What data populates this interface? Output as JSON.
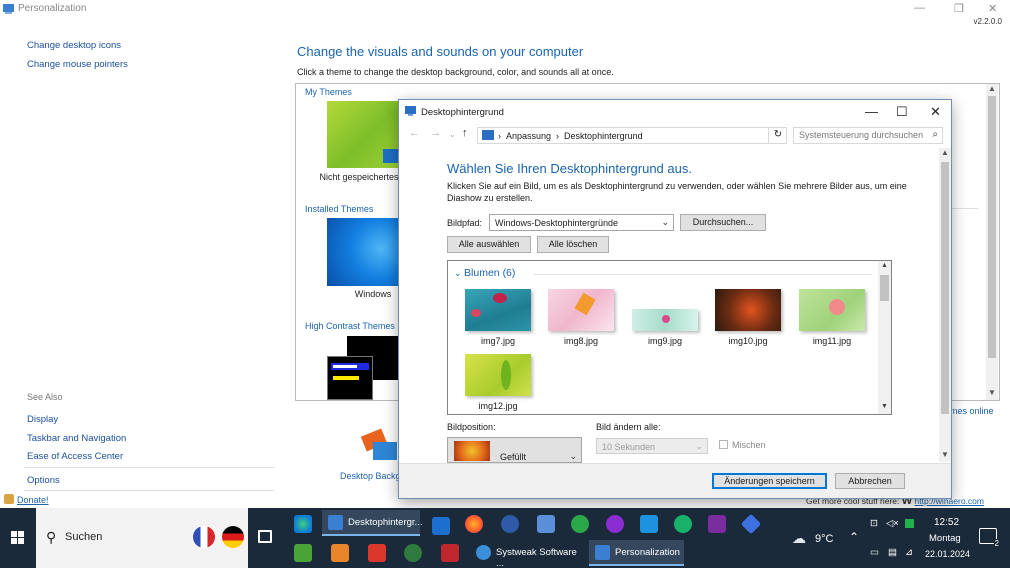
{
  "personalization": {
    "title": "Personalization",
    "version": "v2.2.0.0",
    "left_links": [
      "Change desktop icons",
      "Change mouse pointers"
    ],
    "see_also_label": "See Also",
    "see_also_links": [
      "Display",
      "Taskbar and Navigation",
      "Ease of Access Center",
      "Options"
    ],
    "donate": "Donate!",
    "heading": "Change the visuals and sounds on your computer",
    "subheading": "Click a theme to change the desktop background, color, and sounds all at once.",
    "groups": {
      "my": "My Themes",
      "installed": "Installed Themes",
      "high_contrast": "High Contrast Themes"
    },
    "theme_captions": {
      "unsaved": "Nicht gespeichertes",
      "windows": "Windows"
    },
    "more_online": "mes online",
    "bottom_item": "Desktop Backg",
    "get_more": {
      "text": "Get more cool stuff here:",
      "w": "W",
      "link": "http://winaero.com"
    }
  },
  "dialog": {
    "title": "Desktophintergrund",
    "breadcrumb": [
      "Anpassung",
      "Desktophintergrund"
    ],
    "search_placeholder": "Systemsteuerung durchsuchen",
    "heading": "Wählen Sie Ihren Desktophintergrund aus.",
    "description": "Klicken Sie auf ein Bild, um es als Desktophintergrund zu verwenden, oder wählen Sie mehrere Bilder aus, um eine Diashow zu erstellen.",
    "path_label": "Bildpfad:",
    "path_value": "Windows-Desktophintergründe",
    "browse": "Durchsuchen...",
    "select_all": "Alle auswählen",
    "clear_all": "Alle löschen",
    "group": "Blumen (6)",
    "images": [
      "img7.jpg",
      "img8.jpg",
      "img9.jpg",
      "img10.jpg",
      "img11.jpg",
      "img12.jpg"
    ],
    "position_label": "Bildposition:",
    "position_value": "Gefüllt",
    "change_label": "Bild ändern alle:",
    "change_value": "10 Sekunden",
    "shuffle": "Mischen",
    "save": "Änderungen speichern",
    "cancel": "Abbrechen"
  },
  "taskbar": {
    "search": "Suchen",
    "apps": [
      "Desktophintergr...",
      "Systweak Software ...",
      "Personalization"
    ],
    "weather": "9°C",
    "time": "12:52",
    "day": "Montag",
    "date": "22.01.2024",
    "notifications": "2"
  },
  "colors": {
    "accent": "#1a64b0",
    "taskbar": "#1b2a3a"
  }
}
